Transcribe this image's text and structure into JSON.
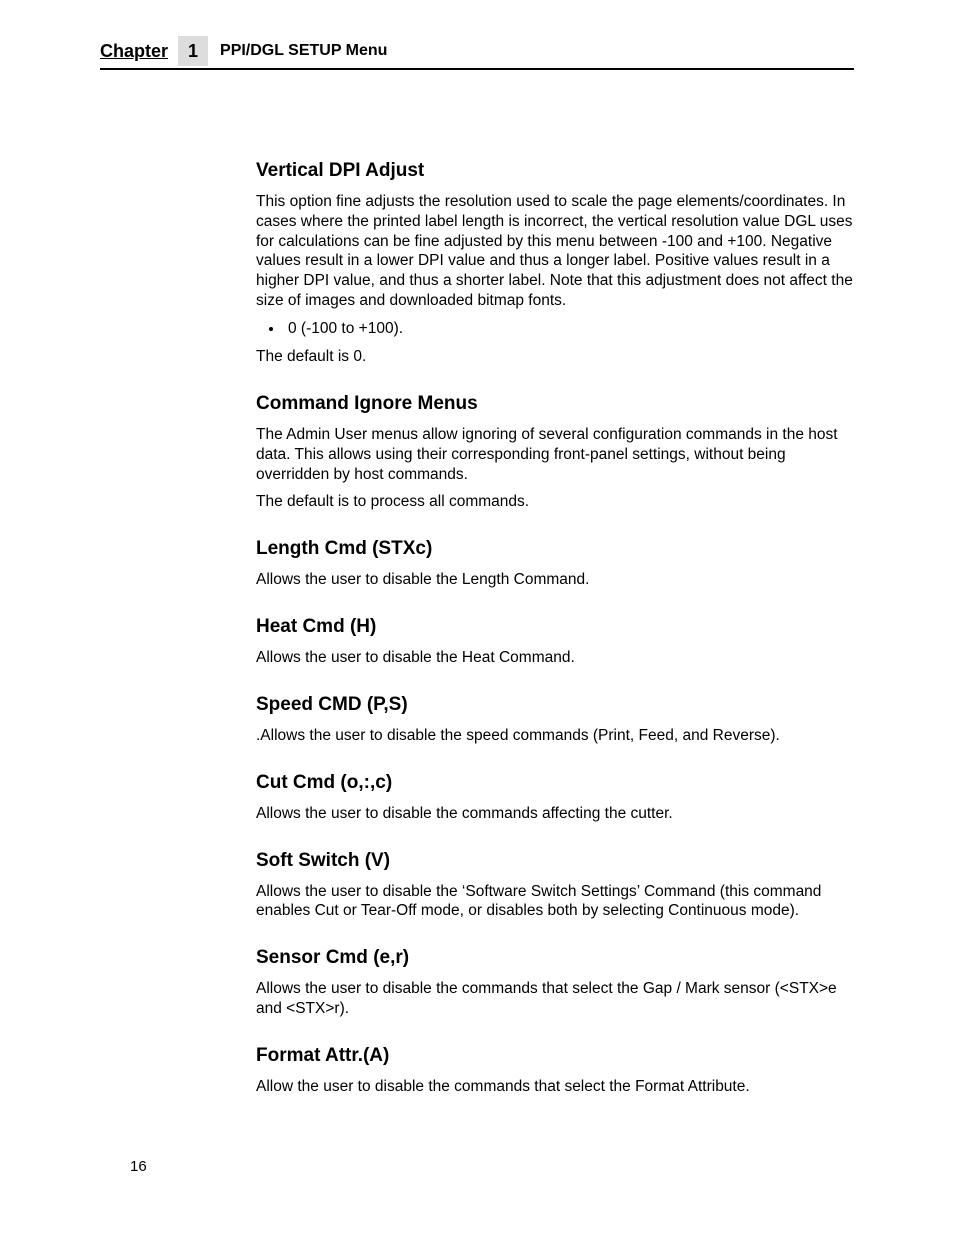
{
  "header": {
    "chapter_label": "Chapter",
    "chapter_number": "1",
    "menu_title": "PPI/DGL SETUP Menu"
  },
  "sections": {
    "vertical_dpi": {
      "heading": "Vertical DPI Adjust",
      "body": "This option fine adjusts the resolution used to scale the page elements/coordinates. In cases where the printed label length is incorrect, the vertical resolution value DGL uses for calculations can be fine adjusted by this menu between -100 and +100. Negative values result in a lower DPI value and thus a longer label. Positive values result in a higher DPI value, and thus a shorter label. Note that this adjustment does not affect the size of images and downloaded bitmap fonts.",
      "bullet": "0 (-100 to +100).",
      "default": "The default is 0."
    },
    "command_ignore": {
      "heading": "Command Ignore Menus",
      "body": "The Admin User menus allow ignoring of several configuration commands in the host data. This allows using their corresponding front-panel settings, without being overridden by host commands.",
      "default": "The default is to process all commands."
    },
    "length_cmd": {
      "heading": "Length Cmd (STXc)",
      "body": "Allows the user to disable the Length Command."
    },
    "heat_cmd": {
      "heading": "Heat Cmd (H)",
      "body": "Allows the user to disable the Heat Command."
    },
    "speed_cmd": {
      "heading": "Speed CMD (P,S)",
      "body": ".Allows the user to disable the speed commands (Print, Feed, and Reverse)."
    },
    "cut_cmd": {
      "heading": "Cut Cmd (o,:,c)",
      "body": "Allows the user to disable the commands affecting the cutter."
    },
    "soft_switch": {
      "heading": "Soft Switch (V)",
      "body": "Allows the user to disable the ‘Software Switch Settings’ Command (this command enables Cut or Tear-Off mode, or disables both by selecting Continuous mode)."
    },
    "sensor_cmd": {
      "heading": "Sensor Cmd (e,r)",
      "body": "Allows the user to disable the commands that select the Gap / Mark sensor (<STX>e and <STX>r)."
    },
    "format_attr": {
      "heading": "Format Attr.(A)",
      "body": "Allow the user to disable the commands that select the Format Attribute."
    }
  },
  "page_number": "16"
}
